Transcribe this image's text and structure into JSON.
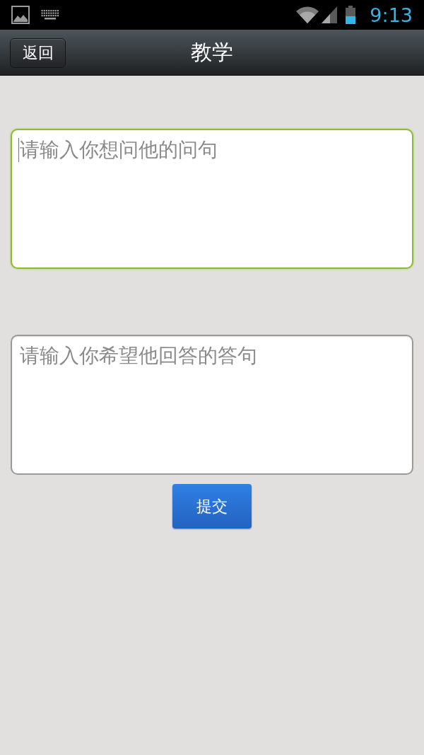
{
  "status_bar": {
    "time": "9:13"
  },
  "header": {
    "back_button": "返回",
    "title": "教学"
  },
  "fields": [
    {
      "placeholder": "请输入你想问他的问句",
      "focused": true
    },
    {
      "placeholder": "请输入你希望他回答的答句",
      "focused": false
    }
  ],
  "submit_button": "提交"
}
